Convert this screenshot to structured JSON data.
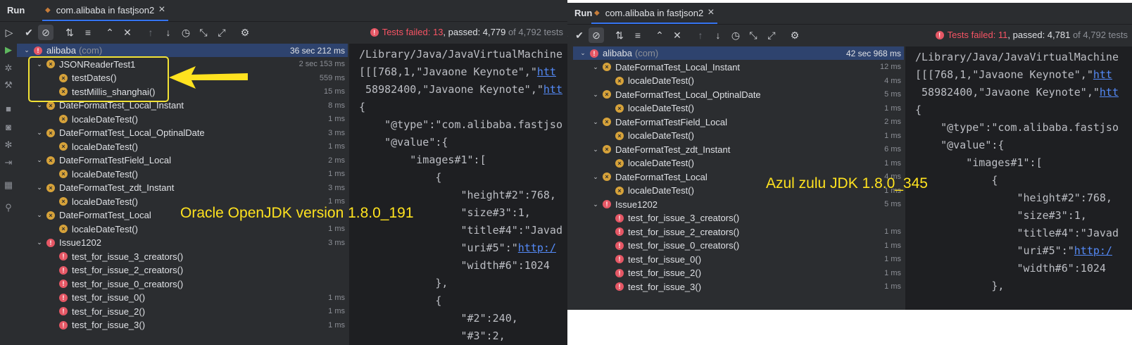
{
  "left": {
    "run_label": "Run",
    "tab": "com.alibaba in fastjson2",
    "status": {
      "failed": "Tests failed: 13",
      "passed": ", passed: 4,779",
      "of": " of 4,792 tests"
    },
    "tree": [
      {
        "level": 0,
        "label": "alibaba",
        "pkg": "(com)",
        "icon": "err",
        "arrow": true,
        "time": "36 sec 212 ms",
        "selected": true
      },
      {
        "level": 1,
        "label": "JSONReaderTest1",
        "icon": "warn",
        "arrow": true,
        "time": "2 sec 153 ms"
      },
      {
        "level": 2,
        "label": "testDates()",
        "icon": "warn",
        "time": "559 ms"
      },
      {
        "level": 2,
        "label": "testMillis_shanghai()",
        "icon": "warn",
        "time": "15 ms"
      },
      {
        "level": 1,
        "label": "DateFormatTest_Local_Instant",
        "icon": "warn",
        "arrow": true,
        "time": "8 ms"
      },
      {
        "level": 2,
        "label": "localeDateTest()",
        "icon": "warn",
        "time": "1 ms"
      },
      {
        "level": 1,
        "label": "DateFormatTest_Local_OptinalDate",
        "icon": "warn",
        "arrow": true,
        "time": "3 ms"
      },
      {
        "level": 2,
        "label": "localeDateTest()",
        "icon": "warn",
        "time": "1 ms"
      },
      {
        "level": 1,
        "label": "DateFormatTestField_Local",
        "icon": "warn",
        "arrow": true,
        "time": "2 ms"
      },
      {
        "level": 2,
        "label": "localeDateTest()",
        "icon": "warn",
        "time": "1 ms"
      },
      {
        "level": 1,
        "label": "DateFormatTest_zdt_Instant",
        "icon": "warn",
        "arrow": true,
        "time": "3 ms"
      },
      {
        "level": 2,
        "label": "localeDateTest()",
        "icon": "warn",
        "time": "1 ms"
      },
      {
        "level": 1,
        "label": "DateFormatTest_Local",
        "icon": "warn",
        "arrow": true,
        "time": ""
      },
      {
        "level": 2,
        "label": "localeDateTest()",
        "icon": "warn",
        "time": "1 ms"
      },
      {
        "level": 1,
        "label": "Issue1202",
        "icon": "err",
        "arrow": true,
        "time": "3 ms"
      },
      {
        "level": 2,
        "label": "test_for_issue_3_creators()",
        "icon": "err",
        "time": ""
      },
      {
        "level": 2,
        "label": "test_for_issue_2_creators()",
        "icon": "err",
        "time": ""
      },
      {
        "level": 2,
        "label": "test_for_issue_0_creators()",
        "icon": "err",
        "time": ""
      },
      {
        "level": 2,
        "label": "test_for_issue_0()",
        "icon": "err",
        "time": "1 ms"
      },
      {
        "level": 2,
        "label": "test_for_issue_2()",
        "icon": "err",
        "time": "1 ms"
      },
      {
        "level": 2,
        "label": "test_for_issue_3()",
        "icon": "err",
        "time": "1 ms"
      }
    ],
    "console": [
      "/Library/Java/JavaVirtualMachine",
      "[[[768,1,\"Javaone Keynote\",\"|htt",
      " 58982400,\"Javaone Keynote\",\"|htt",
      "{",
      "    \"@type\":\"com.alibaba.fastjso",
      "    \"@value\":{",
      "        \"images#1\":[",
      "            {",
      "                \"height#2\":768,",
      "                \"size#3\":1,",
      "                \"title#4\":\"Javad",
      "                \"uri#5\":\"|http:/",
      "                \"width#6\":1024",
      "            },",
      "            {",
      "                \"#2\":240,",
      "                \"#3\":2,"
    ],
    "annotation": "Oracle OpenJDK version 1.8.0_191"
  },
  "right": {
    "run_label": "Run",
    "tab": "com.alibaba in fastjson2",
    "status": {
      "failed": "Tests failed: 11",
      "passed": ", passed: 4,781",
      "of": " of 4,792 tests"
    },
    "tree": [
      {
        "level": 0,
        "label": "alibaba",
        "pkg": "(com)",
        "icon": "err",
        "arrow": true,
        "time": "42 sec 968 ms",
        "selected": true
      },
      {
        "level": 1,
        "label": "DateFormatTest_Local_Instant",
        "icon": "warn",
        "arrow": true,
        "time": "12 ms"
      },
      {
        "level": 2,
        "label": "localeDateTest()",
        "icon": "warn",
        "time": "4 ms"
      },
      {
        "level": 1,
        "label": "DateFormatTest_Local_OptinalDate",
        "icon": "warn",
        "arrow": true,
        "time": "5 ms"
      },
      {
        "level": 2,
        "label": "localeDateTest()",
        "icon": "warn",
        "time": "1 ms"
      },
      {
        "level": 1,
        "label": "DateFormatTestField_Local",
        "icon": "warn",
        "arrow": true,
        "time": "2 ms"
      },
      {
        "level": 2,
        "label": "localeDateTest()",
        "icon": "warn",
        "time": "1 ms"
      },
      {
        "level": 1,
        "label": "DateFormatTest_zdt_Instant",
        "icon": "warn",
        "arrow": true,
        "time": "6 ms"
      },
      {
        "level": 2,
        "label": "localeDateTest()",
        "icon": "warn",
        "time": "1 ms"
      },
      {
        "level": 1,
        "label": "DateFormatTest_Local",
        "icon": "warn",
        "arrow": true,
        "time": "4 ms"
      },
      {
        "level": 2,
        "label": "localeDateTest()",
        "icon": "warn",
        "time": "1 ms"
      },
      {
        "level": 1,
        "label": "Issue1202",
        "icon": "err",
        "arrow": true,
        "time": "5 ms"
      },
      {
        "level": 2,
        "label": "test_for_issue_3_creators()",
        "icon": "err",
        "time": ""
      },
      {
        "level": 2,
        "label": "test_for_issue_2_creators()",
        "icon": "err",
        "time": "1 ms"
      },
      {
        "level": 2,
        "label": "test_for_issue_0_creators()",
        "icon": "err",
        "time": "1 ms"
      },
      {
        "level": 2,
        "label": "test_for_issue_0()",
        "icon": "err",
        "time": "1 ms"
      },
      {
        "level": 2,
        "label": "test_for_issue_2()",
        "icon": "err",
        "time": "1 ms"
      },
      {
        "level": 2,
        "label": "test_for_issue_3()",
        "icon": "err",
        "time": "1 ms"
      }
    ],
    "console": [
      "/Library/Java/JavaVirtualMachine",
      "[[[768,1,\"Javaone Keynote\",\"|htt",
      " 58982400,\"Javaone Keynote\",\"|htt",
      "{",
      "    \"@type\":\"com.alibaba.fastjso",
      "    \"@value\":{",
      "        \"images#1\":[",
      "            {",
      "                \"height#2\":768,",
      "                \"size#3\":1,",
      "                \"title#4\":\"Javad",
      "                \"uri#5\":\"|http:/",
      "                \"width#6\":1024",
      "            },"
    ],
    "annotation": "Azul zulu  JDK 1.8.0_345"
  },
  "colors": {
    "error": "#e55765",
    "warning": "#d6a23a",
    "annotation": "#ffe21f",
    "link": "#548af7"
  }
}
